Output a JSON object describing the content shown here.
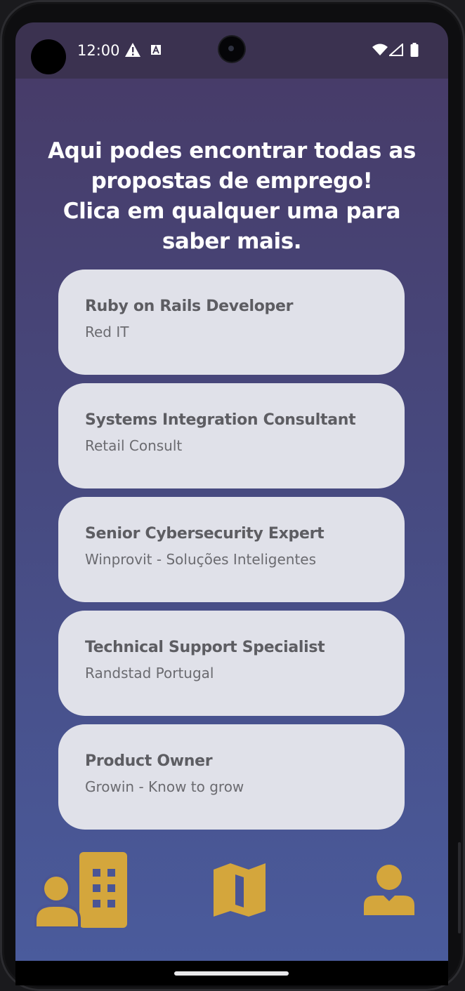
{
  "status_bar": {
    "time": "12:00",
    "icons": [
      "camera-hole",
      "warning-icon",
      "a-notification-icon",
      "wifi-icon",
      "signal-icon",
      "battery-icon"
    ]
  },
  "headline": {
    "lines": [
      "Aqui podes encontrar todas as",
      "propostas de emprego!",
      "Clica em qualquer uma para",
      "saber mais."
    ]
  },
  "jobs": [
    {
      "title": "Ruby on Rails Developer",
      "company": "Red IT"
    },
    {
      "title": "Systems Integration Consultant",
      "company": "Retail Consult"
    },
    {
      "title": "Senior Cybersecurity Expert",
      "company": "Winprovit - Soluções Inteligentes"
    },
    {
      "title": "Technical Support Specialist",
      "company": "Randstad Portugal"
    },
    {
      "title": "Product Owner",
      "company": "Growin - Know to grow"
    }
  ],
  "bottom_nav": {
    "items": [
      {
        "icon": "companies-icon"
      },
      {
        "icon": "map-icon"
      },
      {
        "icon": "profile-icon"
      }
    ]
  },
  "colors": {
    "background_top": "#473c69",
    "background_bottom": "#4a5b9c",
    "card": "#e0e1e9",
    "card_title": "#5d5d62",
    "accent_icons": "#d4a63c",
    "status_bar": "#3b3250"
  }
}
